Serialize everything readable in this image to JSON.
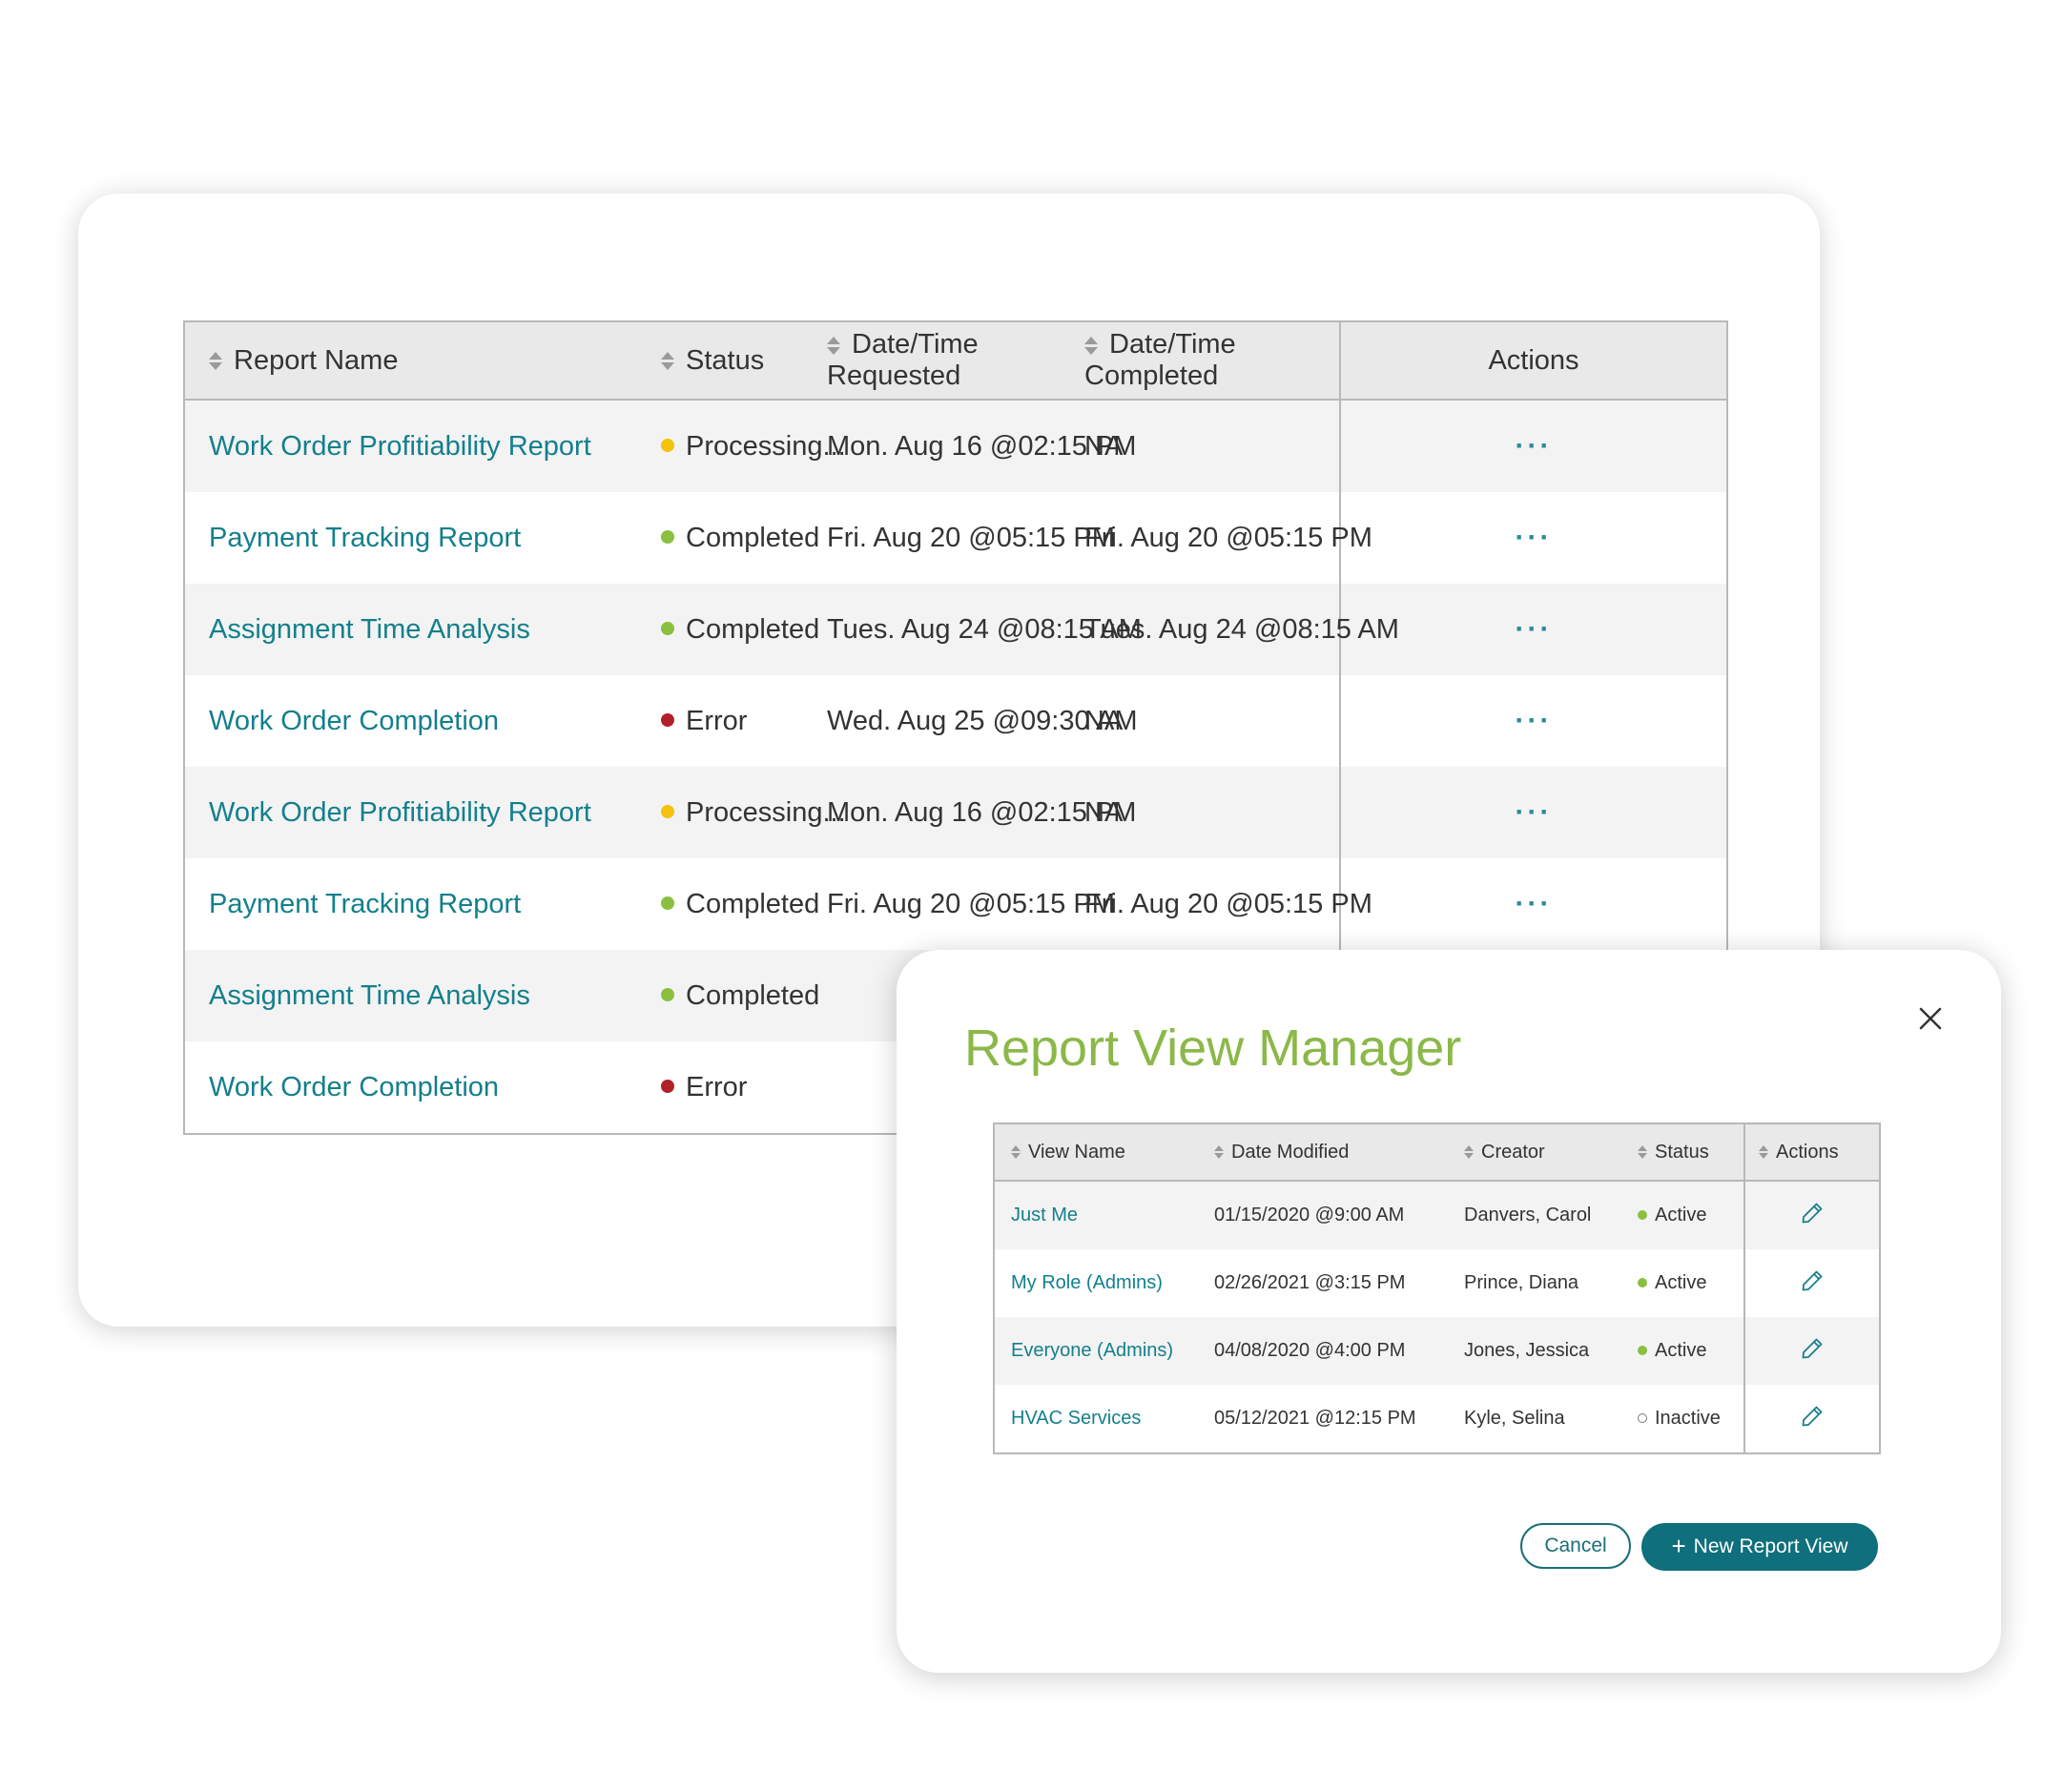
{
  "reports_table": {
    "headers": [
      "Report Name",
      "Status",
      "Date/Time Requested",
      "Date/Time Completed",
      "Actions"
    ],
    "rows": [
      {
        "name": "Work Order Profitiability Report",
        "status": "Processing...",
        "status_color": "#f4c20d",
        "requested": "Mon. Aug 16 @02:15 PM",
        "completed": "NA",
        "actions": "···"
      },
      {
        "name": "Payment Tracking Report",
        "status": "Completed",
        "status_color": "#8bbf3f",
        "requested": "Fri. Aug 20 @05:15 PM",
        "completed": "Fri. Aug 20 @05:15 PM",
        "actions": "···"
      },
      {
        "name": "Assignment Time Analysis",
        "status": "Completed",
        "status_color": "#8bbf3f",
        "requested": "Tues. Aug 24 @08:15 AM",
        "completed": "Tues. Aug 24 @08:15 AM",
        "actions": "···"
      },
      {
        "name": "Work Order Completion",
        "status": "Error",
        "status_color": "#b3202a",
        "requested": "Wed. Aug 25 @09:30 AM",
        "completed": "NA",
        "actions": "···"
      },
      {
        "name": "Work Order Profitiability Report",
        "status": "Processing...",
        "status_color": "#f4c20d",
        "requested": "Mon. Aug 16 @02:15 PM",
        "completed": "NA",
        "actions": "···"
      },
      {
        "name": "Payment Tracking Report",
        "status": "Completed",
        "status_color": "#8bbf3f",
        "requested": "Fri. Aug 20 @05:15 PM",
        "completed": "Fri. Aug 20 @05:15 PM",
        "actions": "···"
      },
      {
        "name": "Assignment Time Analysis",
        "status": "Completed",
        "status_color": "#8bbf3f",
        "requested": "",
        "completed": "",
        "actions": ""
      },
      {
        "name": "Work Order Completion",
        "status": "Error",
        "status_color": "#b3202a",
        "requested": "",
        "completed": "",
        "actions": ""
      }
    ]
  },
  "modal": {
    "title": "Report View Manager",
    "close_icon": "close-icon",
    "headers": [
      "View Name",
      "Date Modified",
      "Creator",
      "Status",
      "Actions"
    ],
    "rows": [
      {
        "view": "Just Me",
        "modified": "01/15/2020 @9:00 AM",
        "creator": "Danvers, Carol",
        "status": "Active",
        "active": true
      },
      {
        "view": "My Role (Admins)",
        "modified": "02/26/2021 @3:15 PM",
        "creator": "Prince, Diana",
        "status": "Active",
        "active": true
      },
      {
        "view": "Everyone (Admins)",
        "modified": "04/08/2020 @4:00 PM",
        "creator": "Jones, Jessica",
        "status": "Active",
        "active": true
      },
      {
        "view": "HVAC Services",
        "modified": "05/12/2021 @12:15 PM",
        "creator": "Kyle, Selina",
        "status": "Inactive",
        "active": false
      }
    ],
    "edit_icon": "pencil-icon",
    "cancel_label": "Cancel",
    "new_label": "New Report View",
    "new_icon": "+"
  },
  "colors": {
    "link": "#137f8c",
    "title": "#8bb848",
    "primary_button": "#0f6f7c",
    "active_dot": "#8bbf3f",
    "processing_dot": "#f4c20d",
    "error_dot": "#b3202a"
  }
}
